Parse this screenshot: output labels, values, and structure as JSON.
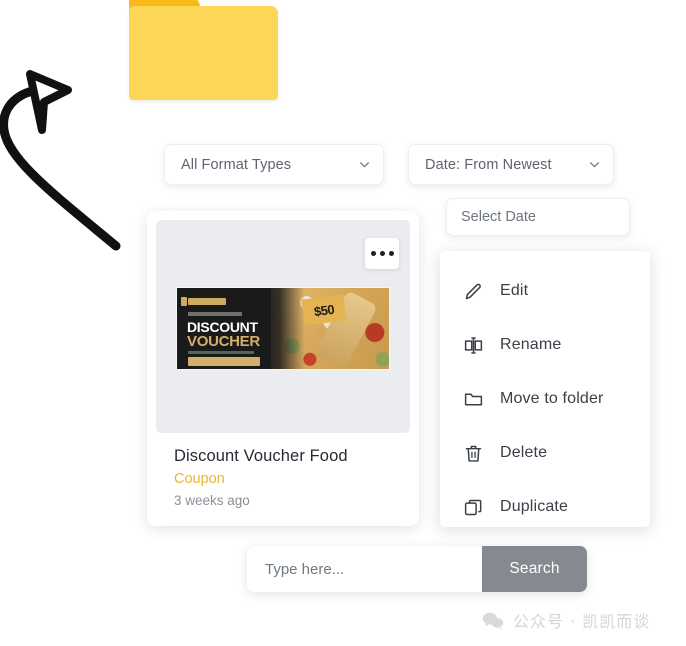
{
  "folder": {
    "name": "folder-icon",
    "body_color": "#FCD757",
    "tab_color": "#F9B919"
  },
  "annotation": {
    "arrow": "curved-hand-drawn-arrow",
    "color": "#111111"
  },
  "filters": {
    "format": {
      "label": "All Format Types",
      "chevron": "chevron-down-icon"
    },
    "date_sort": {
      "label": "Date: From Newest",
      "chevron": "chevron-down-icon"
    },
    "select_date": {
      "value": "",
      "placeholder": "Select Date"
    }
  },
  "card": {
    "more_button": "ellipsis-icon",
    "thumbnail": {
      "headline": "DISCOUNT",
      "subhead": "VOUCHER",
      "amount": "$50"
    },
    "title": "Discount Voucher Food",
    "tag": "Coupon",
    "tag_color": "#E8B833",
    "time": "3 weeks ago"
  },
  "context_menu": {
    "items": [
      {
        "label": "Edit",
        "icon": "pencil-icon"
      },
      {
        "label": "Rename",
        "icon": "rename-icon"
      },
      {
        "label": "Move to folder",
        "icon": "folder-icon"
      },
      {
        "label": "Delete",
        "icon": "trash-icon"
      },
      {
        "label": "Duplicate",
        "icon": "duplicate-icon"
      }
    ]
  },
  "search": {
    "value": "",
    "placeholder": "Type here...",
    "button_label": "Search",
    "button_color": "#868A90"
  },
  "watermark": {
    "icon": "wechat-icon",
    "text": "公众号 · 凯凯而谈"
  }
}
